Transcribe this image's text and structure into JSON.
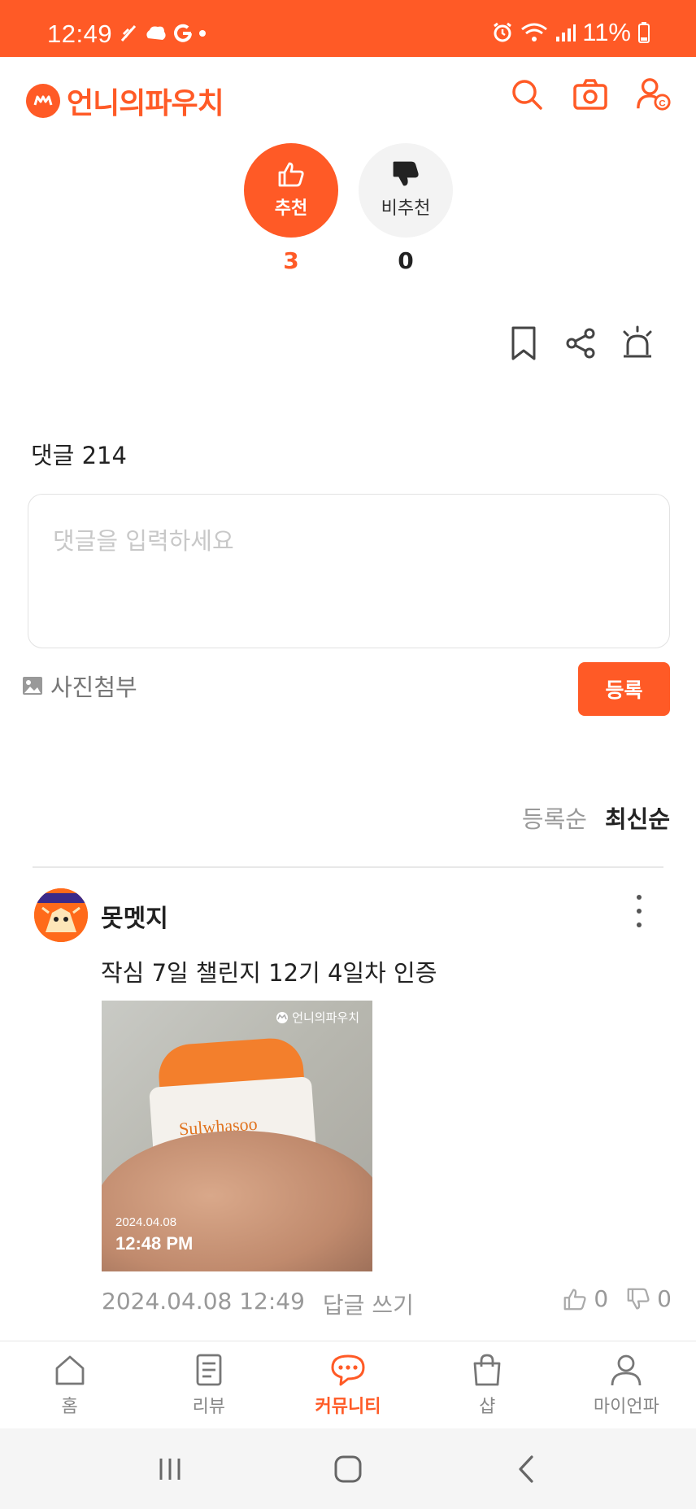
{
  "status_bar": {
    "time": "12:49",
    "battery": "11%"
  },
  "header": {
    "app_name": "언니의파우치"
  },
  "vote": {
    "up_label": "추천",
    "up_count": "3",
    "down_label": "비추천",
    "down_count": "0"
  },
  "comments": {
    "title": "댓글 214",
    "input_placeholder": "댓글을 입력하세요",
    "photo_attach_label": "사진첨부",
    "submit_label": "등록",
    "sort": [
      {
        "label": "등록순",
        "active": false
      },
      {
        "label": "최신순",
        "active": true
      }
    ],
    "items": [
      {
        "username": "못멧지",
        "text": "작심 7일 챌린지 12기 4일차 인증",
        "photo": {
          "watermark": "언니의파우치",
          "brand": "Sulwhasoo",
          "date": "2024.04.08",
          "time": "12:48 PM"
        },
        "timestamp": "2024.04.08 12:49",
        "reply_label": "답글 쓰기",
        "likes": "0",
        "dislikes": "0"
      }
    ]
  },
  "bottom_nav": [
    {
      "label": "홈",
      "icon": "home-icon",
      "active": false
    },
    {
      "label": "리뷰",
      "icon": "review-icon",
      "active": false
    },
    {
      "label": "커뮤니티",
      "icon": "community-icon",
      "active": true
    },
    {
      "label": "샵",
      "icon": "shop-icon",
      "active": false
    },
    {
      "label": "마이언파",
      "icon": "profile-icon",
      "active": false
    }
  ],
  "colors": {
    "accent": "#ff5a26",
    "muted": "#999999",
    "text": "#222222"
  }
}
